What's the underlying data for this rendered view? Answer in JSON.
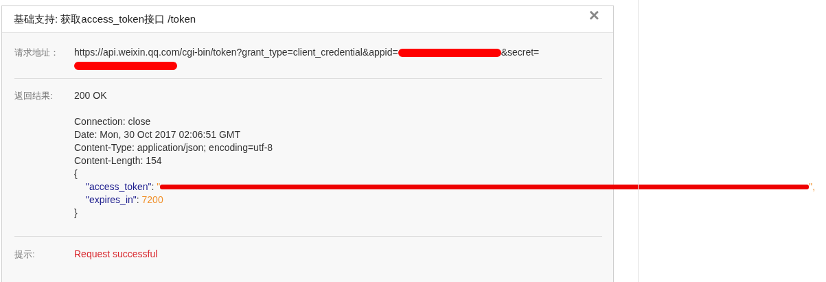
{
  "dialog": {
    "title": "基础支持: 获取access_token接口 /token",
    "close": "×"
  },
  "request": {
    "label": "请求地址：",
    "url_segments": [
      {
        "kind": "text",
        "text": "https://api.weixin.qq.com/cgi-bin/token?grant_type=client_credential&appid="
      },
      {
        "kind": "redaction"
      },
      {
        "kind": "text",
        "text": "&secret="
      },
      {
        "kind": "redaction"
      }
    ]
  },
  "result": {
    "label": "返回结果:",
    "status": "200 OK",
    "headers": [
      "Connection: close",
      "Date: Mon, 30 Oct 2017 02:06:51 GMT",
      "Content-Type: application/json; encoding=utf-8",
      "Content-Length: 154"
    ],
    "body_open": "{",
    "body_fields": [
      {
        "key": "\"access_token\"",
        "separator": ": ",
        "value": "\"",
        "redacted": true,
        "tail": "\","
      },
      {
        "key": "\"expires_in\"",
        "separator": ": ",
        "value": "7200",
        "redacted": false
      }
    ],
    "body_close": "}"
  },
  "hint": {
    "label": "提示:",
    "message": "Request successful"
  }
}
